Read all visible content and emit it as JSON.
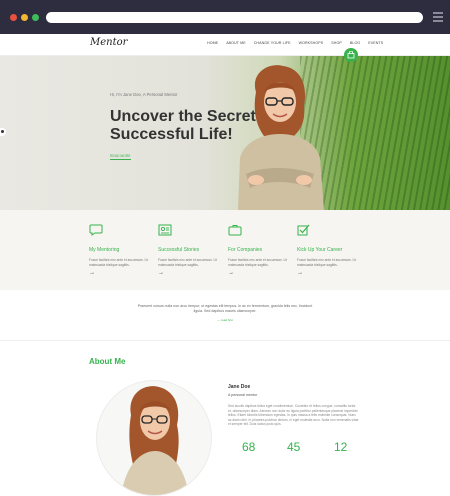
{
  "browser": {
    "icons": [
      "close-dot",
      "minimize-dot",
      "maximize-dot",
      "hamburger-menu-icon"
    ]
  },
  "header": {
    "logo": "Mentor",
    "nav": [
      "HOME",
      "ABOUT ME",
      "CHANGE YOUR LIFE",
      "WORKSHOPS",
      "SHOP",
      "BLOG",
      "EVENTS"
    ]
  },
  "hero": {
    "subtitle": "Hi, I'm Jane Doe, A Personal Mentor",
    "title": "Uncover the Secret of Successful Life!",
    "link": "READ MORE"
  },
  "services": [
    {
      "icon": "chat-bubble-icon",
      "title": "My Mentoring",
      "text": "Fusce facilisis nec ante et accumsan. Ut malesuada tristique sagittis.",
      "arrow": "→"
    },
    {
      "icon": "id-card-icon",
      "title": "Successful Stories",
      "text": "Fusce facilisis nec ante et accumsan. Ut malesuada tristique sagittis.",
      "arrow": "→"
    },
    {
      "icon": "briefcase-icon",
      "title": "For Companies",
      "text": "Fusce facilisis nec ante et accumsan. Ut malesuada tristique sagittis.",
      "arrow": "→"
    },
    {
      "icon": "checkbox-icon",
      "title": "Kick Up Your Career",
      "text": "Fusce facilisis nec ante et accumsan. Ut malesuada tristique sagittis.",
      "arrow": "→"
    }
  ],
  "quote": {
    "text": "Praesent cursus nulla non arcu tempor, ut egestas elit tempus. In ac ex fermentum, gravida felis nec, tincidunt ligula. Sed dapibus mauris ullamcorper.",
    "author": "— read first"
  },
  "about": {
    "heading": "About Me",
    "name": "Jane Doe",
    "role": "A personal mentor",
    "description": "Sed iaculis dapibus tellus eget condimentum. Curabitur et tellus congue, convallis tortor et, ullamcorper diam. Aenean non dolor eu ligula porttitor pellentesque placerat imperdiet tellus. Etiam lobortis bibendum egestas. In quis massa a felis molestie consequat. Nunc ac diam nibh. In pharetra pulvinar dictum, in eget molestie arcu. Nulla non venenatis vitae et semper elit. Duis luctus justo quis.",
    "stats": [
      "68",
      "45",
      "12"
    ]
  },
  "colors": {
    "accent": "#37b24d",
    "chrome": "#2d2d3f"
  }
}
